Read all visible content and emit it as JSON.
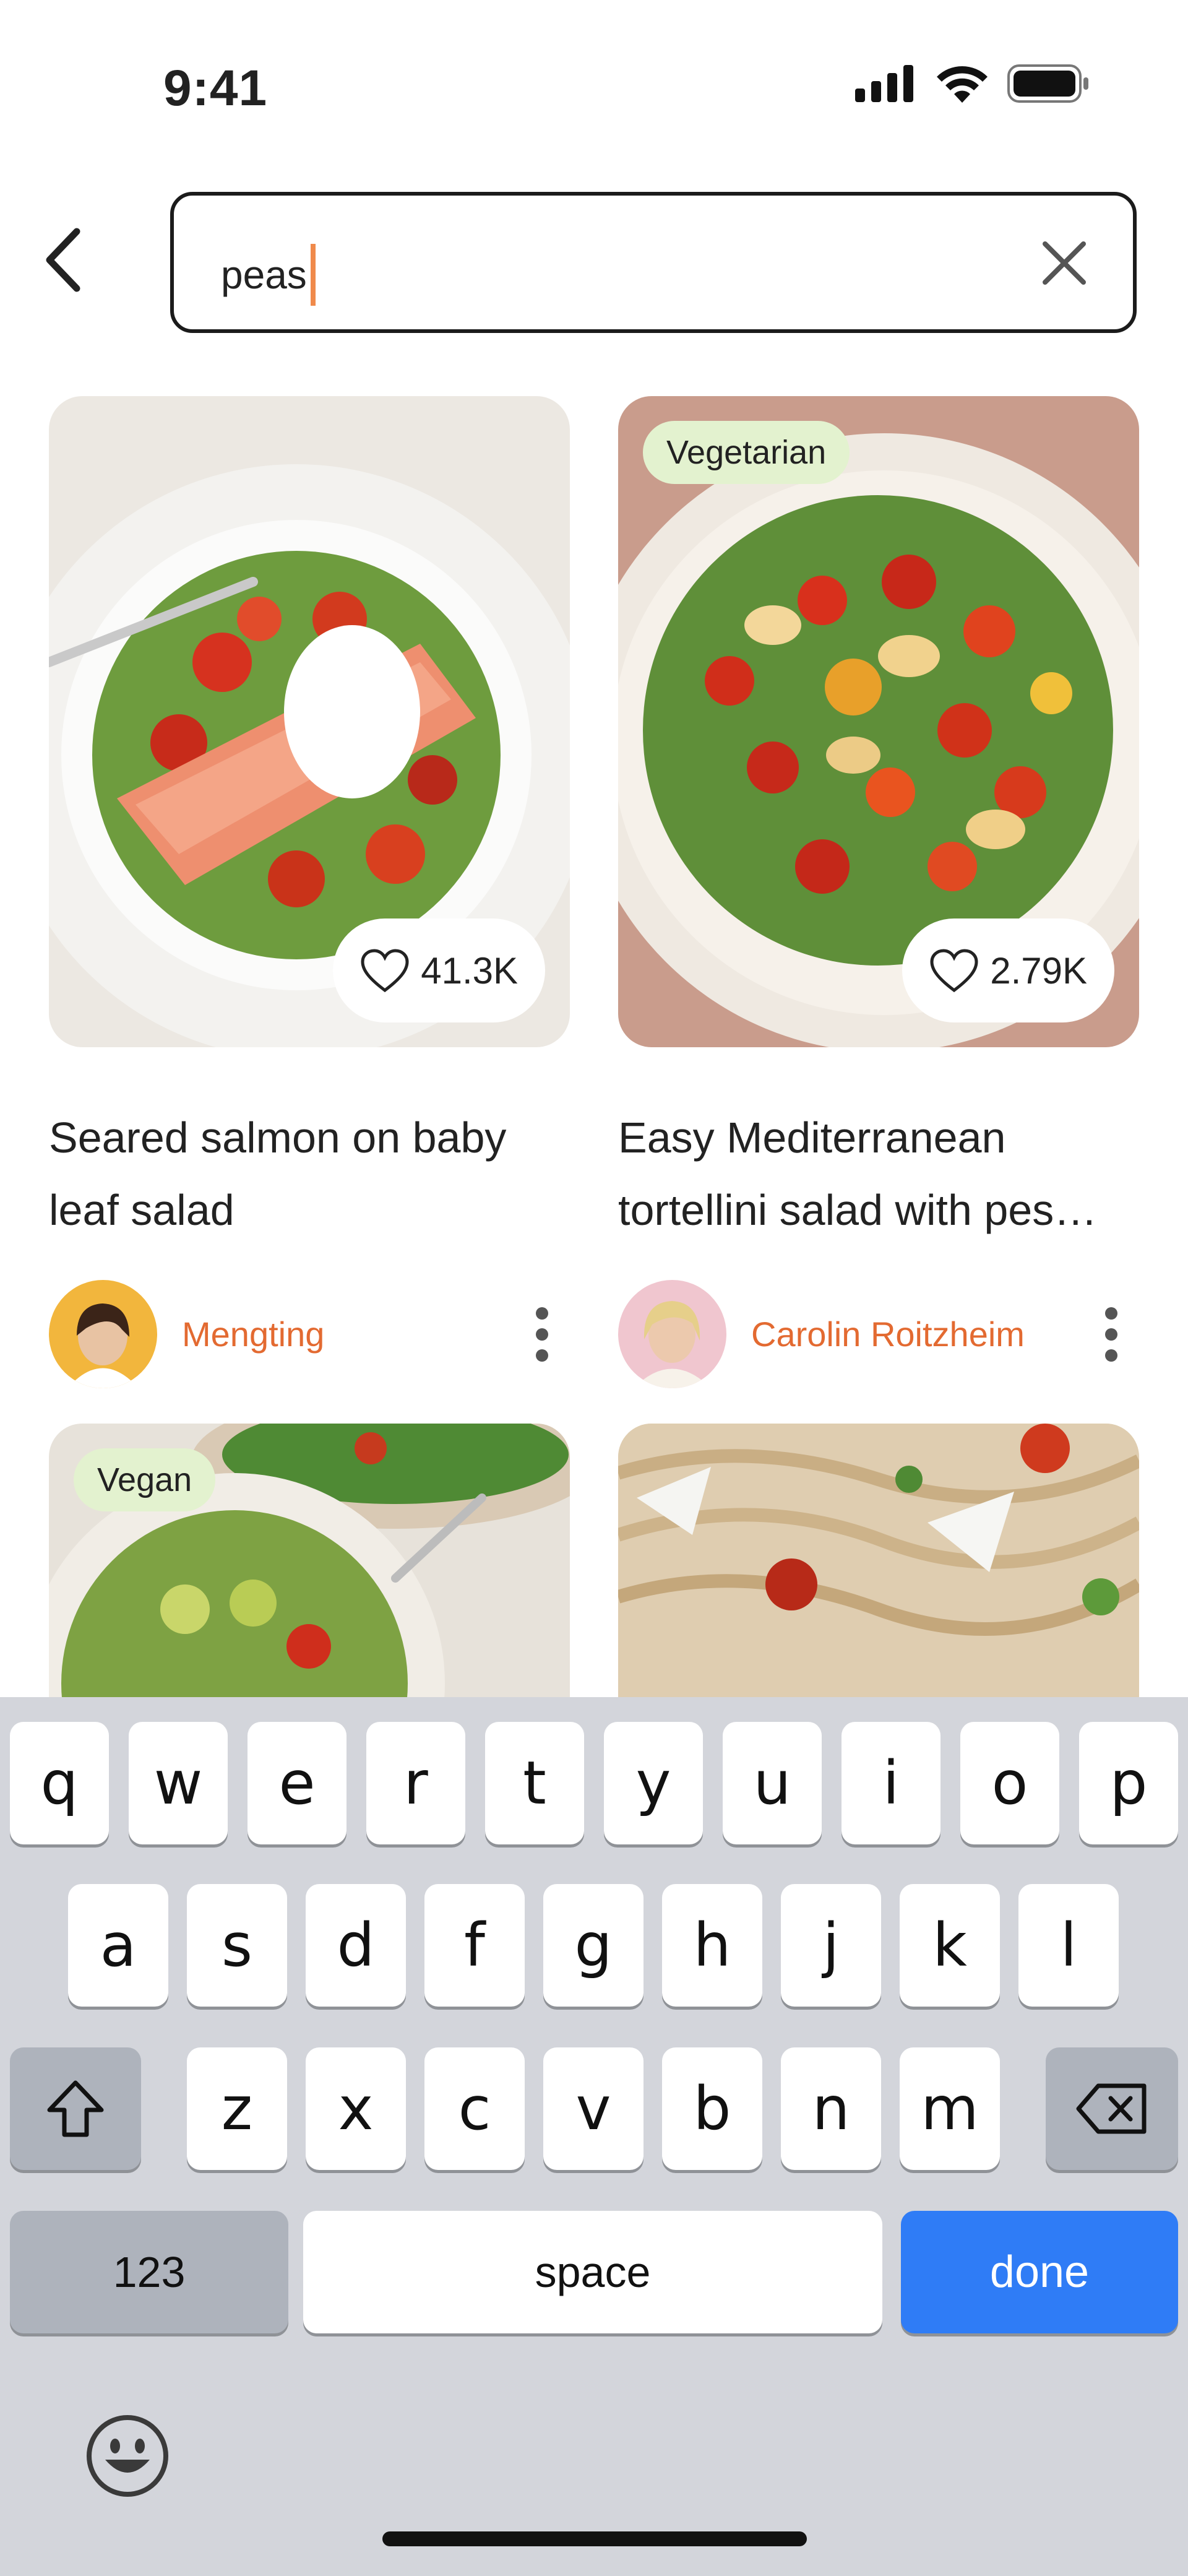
{
  "status_bar": {
    "time": "9:41",
    "icons": [
      "signal-icon",
      "wifi-icon",
      "battery-icon"
    ]
  },
  "search": {
    "value": "peas",
    "back_icon": "chevron-left-icon",
    "clear_icon": "close-icon"
  },
  "results": [
    {
      "title": "Seared salmon on baby leaf salad",
      "tag": "",
      "likes": "41.3K",
      "author": "Mengting"
    },
    {
      "title": "Easy Mediterranean tortellini salad with pes…",
      "tag": "Vegetarian",
      "likes": "2.79K",
      "author": "Carolin Roitzheim"
    },
    {
      "title": "",
      "tag": "Vegan",
      "likes": "",
      "author": ""
    },
    {
      "title": "",
      "tag": "",
      "likes": "",
      "author": ""
    }
  ],
  "keyboard": {
    "row1": [
      "q",
      "w",
      "e",
      "r",
      "t",
      "y",
      "u",
      "i",
      "o",
      "p"
    ],
    "row2": [
      "a",
      "s",
      "d",
      "f",
      "g",
      "h",
      "j",
      "k",
      "l"
    ],
    "row3": [
      "z",
      "x",
      "c",
      "v",
      "b",
      "n",
      "m"
    ],
    "numbers_label": "123",
    "space_label": "space",
    "done_label": "done",
    "icons": [
      "shift-icon",
      "backspace-icon",
      "emoji-icon"
    ]
  },
  "colors": {
    "accent": "#e36a31",
    "tag_bg": "#e3f2cf",
    "caret": "#f08a4b",
    "done": "#2f7cf6",
    "keyboard_bg": "#d3d5db"
  }
}
